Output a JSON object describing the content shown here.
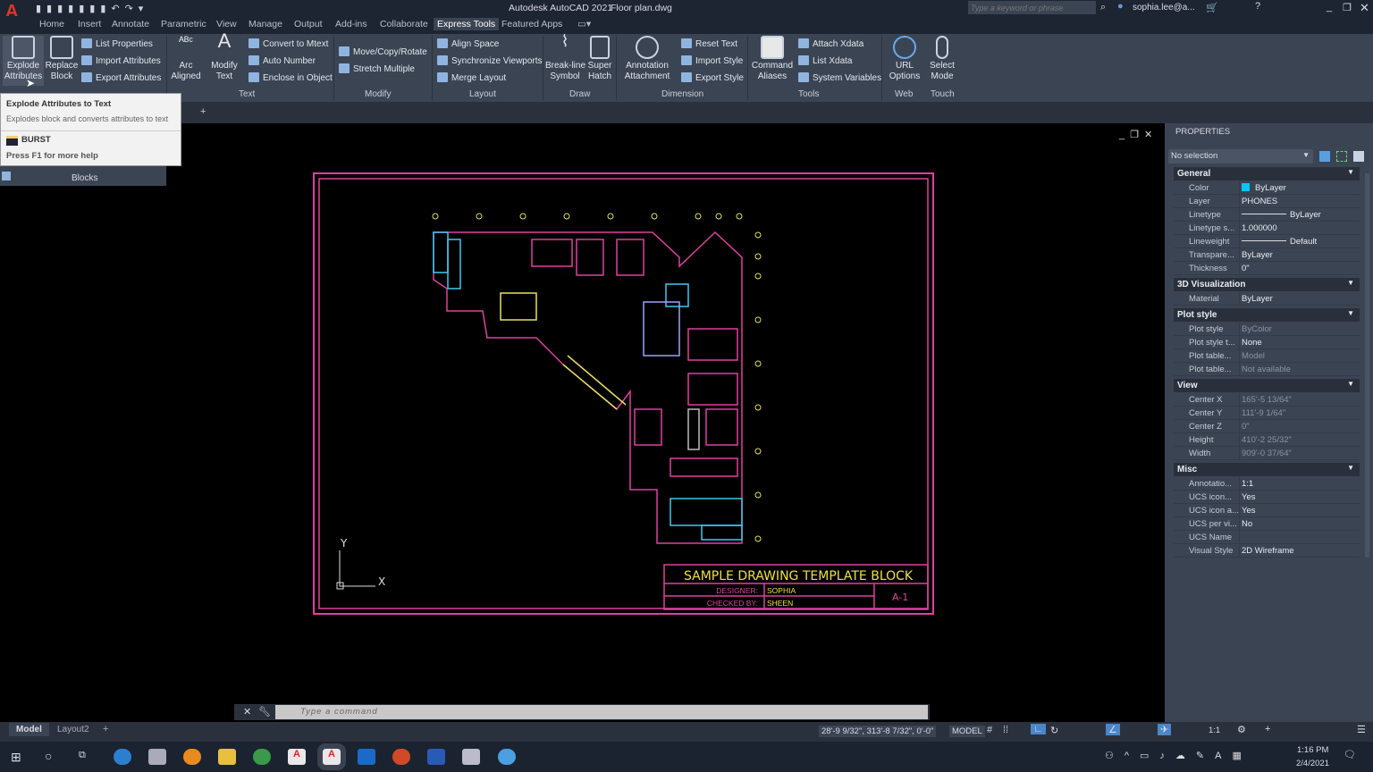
{
  "title_bar": {
    "app": "Autodesk AutoCAD 2021",
    "file": "Floor plan.dwg",
    "search_placeholder": "Type a keyword or phrase",
    "user": "sophia.lee@a..."
  },
  "ribbon_tabs": [
    "Home",
    "Insert",
    "Annotate",
    "Parametric",
    "View",
    "Manage",
    "Output",
    "Add-ins",
    "Collaborate",
    "Express Tools",
    "Featured Apps"
  ],
  "active_tab": "Express Tools",
  "ribbon": {
    "blocks": {
      "explode": "Explode\nAttributes",
      "replace": "Replace\nBlock",
      "list_props": "List Properties",
      "import_attrs": "Import Attributes",
      "export_attrs": "Export Attributes",
      "label": "Blocks"
    },
    "text": {
      "arc": "Arc\nAligned",
      "modify": "Modify\nText",
      "convert": "Convert to Mtext",
      "autonum": "Auto Number",
      "enclose": "Enclose in Object",
      "label": "Text"
    },
    "modify": {
      "move": "Move/Copy/Rotate",
      "stretch": "Stretch Multiple",
      "label": "Modify"
    },
    "layout": {
      "align": "Align Space",
      "sync": "Synchronize Viewports",
      "merge": "Merge Layout",
      "label": "Layout"
    },
    "draw": {
      "breakline": "Break-line\nSymbol",
      "hatch": "Super\nHatch",
      "label": "Draw"
    },
    "dimension": {
      "annot": "Annotation\nAttachment",
      "reset": "Reset Text",
      "import": "Import Style",
      "export": "Export Style",
      "label": "Dimension"
    },
    "tools": {
      "aliases": "Command\nAliases",
      "attach": "Attach Xdata",
      "list": "List Xdata",
      "sysvars": "System Variables",
      "label": "Tools"
    },
    "web": {
      "url": "URL\nOptions",
      "label": "Web"
    },
    "touch": {
      "select": "Select\nMode",
      "label": "Touch"
    }
  },
  "tooltip": {
    "title": "Explode Attributes to Text",
    "desc": "Explodes block and converts attributes to text",
    "command": "BURST",
    "help": "Press F1 for more help"
  },
  "drawing": {
    "title_block": "SAMPLE DRAWING TEMPLATE BLOCK",
    "designer_label": "DESIGNER:",
    "designer": "SOPHIA",
    "checked_label": "CHECKED BY:",
    "checked": "SHEEN",
    "sheet": "A-1",
    "ucs_x": "X",
    "ucs_y": "Y"
  },
  "properties": {
    "title": "PROPERTIES",
    "selection": "No selection",
    "sections": [
      {
        "name": "General",
        "rows": [
          [
            "Color",
            "ByLayer"
          ],
          [
            "Layer",
            "PHONES"
          ],
          [
            "Linetype",
            "ByLayer"
          ],
          [
            "Linetype s...",
            "1.000000"
          ],
          [
            "Lineweight",
            "Default"
          ],
          [
            "Transpare...",
            "ByLayer"
          ],
          [
            "Thickness",
            "0\""
          ]
        ]
      },
      {
        "name": "3D Visualization",
        "rows": [
          [
            "Material",
            "ByLayer"
          ]
        ]
      },
      {
        "name": "Plot style",
        "rows": [
          [
            "Plot style",
            "ByColor"
          ],
          [
            "Plot style t...",
            "None"
          ],
          [
            "Plot table...",
            "Model"
          ],
          [
            "Plot table...",
            "Not available"
          ]
        ]
      },
      {
        "name": "View",
        "rows": [
          [
            "Center X",
            "165'-5 13/64\""
          ],
          [
            "Center Y",
            "111'-9 1/64\""
          ],
          [
            "Center Z",
            "0\""
          ],
          [
            "Height",
            "410'-2 25/32\""
          ],
          [
            "Width",
            "909'-0 37/64\""
          ]
        ]
      },
      {
        "name": "Misc",
        "rows": [
          [
            "Annotatio...",
            "1:1"
          ],
          [
            "UCS icon...",
            "Yes"
          ],
          [
            "UCS icon a...",
            "Yes"
          ],
          [
            "UCS per vi...",
            "No"
          ],
          [
            "UCS Name",
            ""
          ],
          [
            "Visual Style",
            "2D Wireframe"
          ]
        ]
      }
    ],
    "color_swatch": "#00c8ff"
  },
  "command": {
    "placeholder": "Type a command"
  },
  "layout_tabs": [
    "Model",
    "Layout2"
  ],
  "status": {
    "coords": "28'-9 9/32\", 313'-8 7/32\", 0'-0\"",
    "model": "MODEL",
    "scale": "1:1"
  },
  "taskbar": {
    "time": "1:16 PM",
    "date": "2/4/2021"
  }
}
